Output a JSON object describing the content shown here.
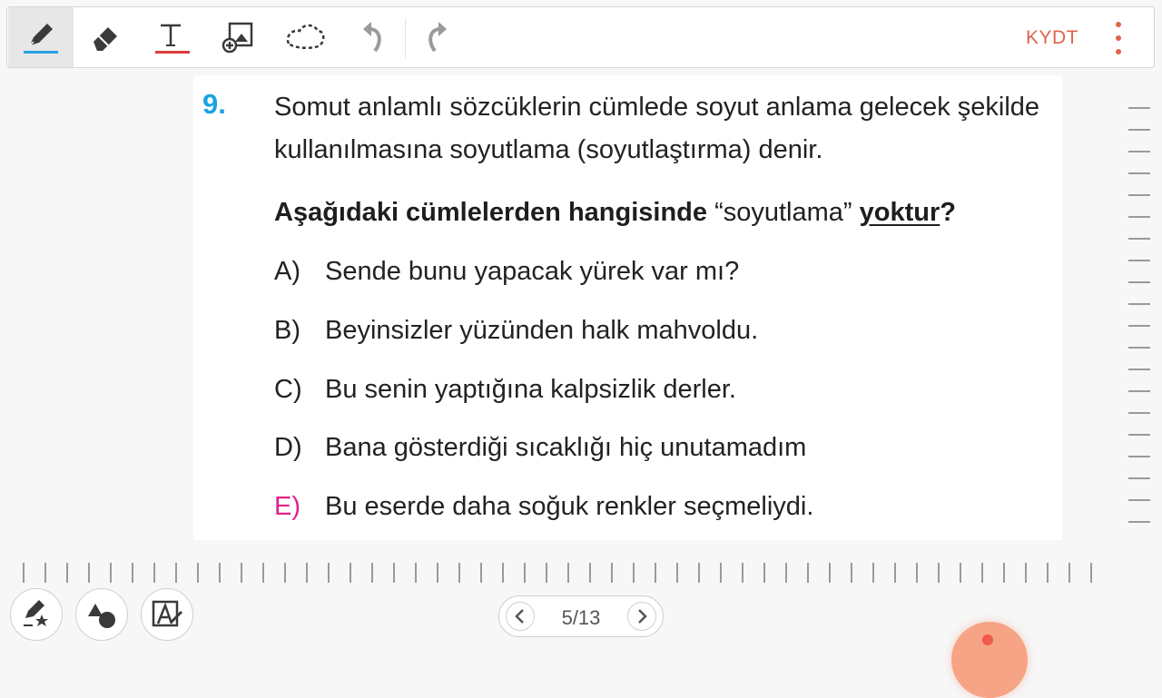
{
  "toolbar": {
    "tools": [
      {
        "name": "pen-icon",
        "active": true
      },
      {
        "name": "eraser-icon",
        "active": false
      },
      {
        "name": "text-icon",
        "active": false
      },
      {
        "name": "add-image-icon",
        "active": false
      },
      {
        "name": "lasso-select-icon",
        "active": false
      },
      {
        "name": "undo-icon",
        "active": false
      },
      {
        "name": "redo-icon",
        "active": false
      }
    ],
    "kydt_label": "KYDT",
    "more_icon": "more-vertical-icon",
    "accent_color": "#e0634a"
  },
  "question": {
    "number": "9.",
    "stem": "Somut anlamlı sözcüklerin cümlede soyut anlama gelecek şekilde kullanılmasına soyutlama (soyutlaştırma) denir.",
    "prompt_bold": "Aşağıdaki cümlelerden hangisinde",
    "prompt_quote": " “soyutlama” ",
    "prompt_underlined": "yoktur",
    "prompt_end": "?",
    "options": [
      {
        "letter": "A)",
        "text": "Sende bunu yapacak yürek var mı?"
      },
      {
        "letter": "B)",
        "text": "Beyinsizler yüzünden halk mahvoldu."
      },
      {
        "letter": "C)",
        "text": "Bu senin yaptığına kalpsizlik derler."
      },
      {
        "letter": "D)",
        "text": "Bana gösterdiği sıcaklığı hiç unutamadım"
      },
      {
        "letter": "E)",
        "text": "Bu eserde daha soğuk renkler seçmeliydi."
      }
    ],
    "highlighted_option": "E)",
    "number_color": "#1aa3de",
    "highlight_color": "#e0218a"
  },
  "bottom_bar": {
    "buttons": [
      "pen-star-icon",
      "shapes-icon",
      "handwriting-to-text-icon"
    ],
    "pager": {
      "current": 5,
      "total": 13,
      "label": "5/13"
    }
  }
}
